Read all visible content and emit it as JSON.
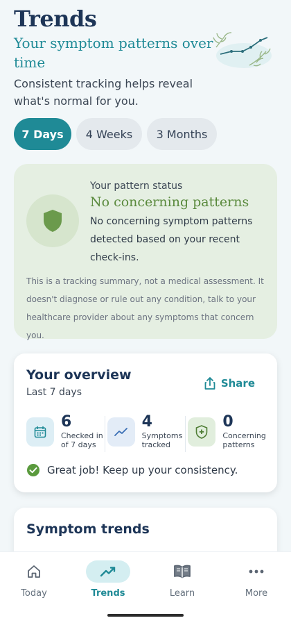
{
  "header": {
    "title": "Trends",
    "subtitle": "Your symptom patterns over time",
    "description": "Consistent tracking helps reveal what's normal for you."
  },
  "segments": [
    {
      "label": "7 Days",
      "active": true
    },
    {
      "label": "4 Weeks",
      "active": false
    },
    {
      "label": "3 Months",
      "active": false
    }
  ],
  "status": {
    "label": "Your pattern status",
    "title": "No concerning patterns",
    "body": "No concerning symptom patterns detected based on your recent check-ins.",
    "disclaimer": "This is a tracking summary, not a medical assessment. It doesn't diagnose or rule out any condition, talk to your healthcare provider about any symptoms that concern you.",
    "icon": "shield-icon"
  },
  "overview": {
    "title": "Your overview",
    "subtitle": "Last 7 days",
    "share_label": "Share",
    "stats": [
      {
        "value": "6",
        "label": "Checked in of 7 days",
        "icon": "calendar-icon"
      },
      {
        "value": "4",
        "label": "Symptoms tracked",
        "icon": "trend-icon"
      },
      {
        "value": "0",
        "label": "Concerning patterns",
        "icon": "shield-plus-icon"
      }
    ],
    "message": "Great job! Keep up your consistency."
  },
  "symptom_trends": {
    "title": "Symptom trends"
  },
  "nav": [
    {
      "label": "Today",
      "icon": "home-icon",
      "active": false
    },
    {
      "label": "Trends",
      "icon": "trend-icon",
      "active": true
    },
    {
      "label": "Learn",
      "icon": "book-icon",
      "active": false
    },
    {
      "label": "More",
      "icon": "more-icon",
      "active": false
    }
  ],
  "colors": {
    "accent": "#1f8a96",
    "navy": "#1d3557",
    "success": "#5a8a3d",
    "status_bg": "#e5efe2"
  }
}
